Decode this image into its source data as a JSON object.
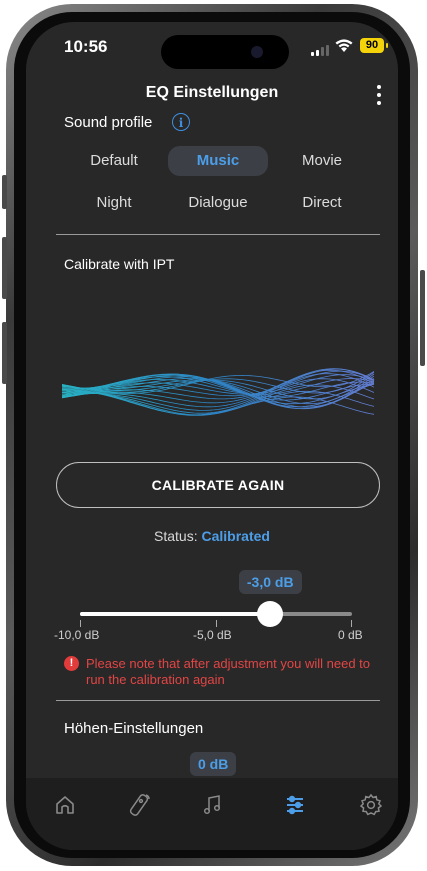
{
  "status_bar": {
    "time": "10:56",
    "battery": "90"
  },
  "header": {
    "title": "EQ Einstellungen"
  },
  "sound_profile": {
    "title": "Sound profile",
    "options": [
      "Default",
      "Music",
      "Movie",
      "Night",
      "Dialogue",
      "Direct"
    ],
    "selected": "Music"
  },
  "calibrate": {
    "title": "Calibrate with IPT",
    "button_label": "CALIBRATE AGAIN",
    "status_label": "Status:",
    "status_value": "Calibrated"
  },
  "slider": {
    "value_label": "-3,0 dB",
    "value": -3.0,
    "min": -10.0,
    "max": 0,
    "tick_labels": [
      "-10,0 dB",
      "-5,0 dB",
      "0 dB"
    ]
  },
  "warning": {
    "text": "Please note that after adjustment you will need to run the calibration again"
  },
  "treble": {
    "title": "Höhen-Einstellungen",
    "value_label": "0 dB"
  },
  "tabs": [
    {
      "icon": "home-icon"
    },
    {
      "icon": "remote-icon"
    },
    {
      "icon": "music-icon"
    },
    {
      "icon": "equalizer-icon",
      "active": true
    },
    {
      "icon": "settings-icon"
    }
  ],
  "colors": {
    "accent": "#4d9ee8",
    "background": "#282828",
    "warning": "#e24545"
  }
}
